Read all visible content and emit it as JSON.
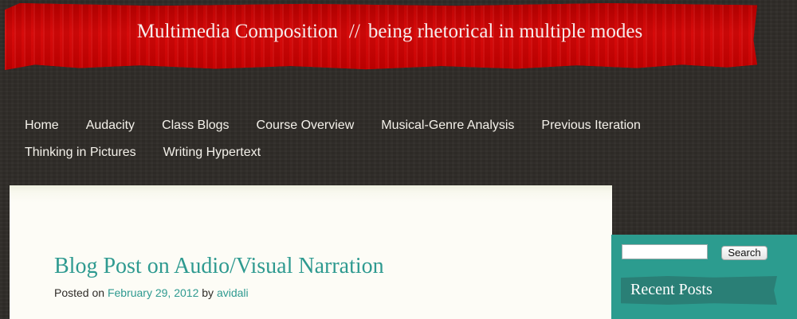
{
  "site": {
    "title": "Multimedia Composition",
    "separator": "//",
    "tagline": "being rhetorical in multiple modes"
  },
  "nav": {
    "items": [
      {
        "label": "Home"
      },
      {
        "label": "Audacity"
      },
      {
        "label": "Class Blogs"
      },
      {
        "label": "Course Overview"
      },
      {
        "label": "Musical-Genre Analysis"
      },
      {
        "label": "Previous Iteration"
      },
      {
        "label": "Thinking in Pictures"
      },
      {
        "label": "Writing Hypertext"
      }
    ]
  },
  "post": {
    "title": "Blog Post on Audio/Visual Narration",
    "posted_on_label": "Posted on",
    "date": "February 29, 2012",
    "by_label": "by",
    "author": "avidali"
  },
  "sidebar": {
    "search_value": "",
    "search_button": "Search",
    "recent_posts_title": "Recent Posts"
  },
  "colors": {
    "banner": "#c50000",
    "background": "#2f2c28",
    "accent": "#2e9a90",
    "sidebar": "#2c9c8f"
  }
}
